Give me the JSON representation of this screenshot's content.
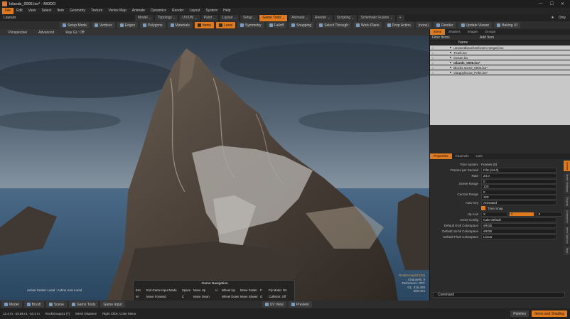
{
  "window": {
    "title": "Islands_0006.lxo* - MODO",
    "controls": [
      "—",
      "☐",
      "✕"
    ]
  },
  "menu": [
    "File",
    "Edit",
    "View",
    "Select",
    "Item",
    "Geometry",
    "Texture",
    "Vertex Map",
    "Animate",
    "Dynamics",
    "Render",
    "Layout",
    "System",
    "Help"
  ],
  "workspace_label": "Layouts",
  "tabs": [
    {
      "label": "Model"
    },
    {
      "label": "Topology"
    },
    {
      "label": "UV/UM"
    },
    {
      "label": "Paint"
    },
    {
      "label": "Layout"
    },
    {
      "label": "Setup"
    },
    {
      "label": "Game Tools",
      "active": true
    },
    {
      "label": "Animate"
    },
    {
      "label": "Render"
    },
    {
      "label": "Scripting"
    },
    {
      "label": "Schematic Fusion"
    }
  ],
  "tab_add": "+",
  "tabbar_right": [
    "★",
    "Only"
  ],
  "toolbar": [
    {
      "label": "Setup Mode",
      "icon": "setup-icon"
    },
    {
      "label": "Vertices",
      "icon": "vertex-icon"
    },
    {
      "label": "Edges",
      "icon": "edge-icon"
    },
    {
      "label": "Polygons",
      "icon": "polygon-icon"
    },
    {
      "label": "Materials",
      "icon": "material-icon"
    },
    {
      "label": "Items",
      "icon": "items-icon",
      "active": true
    },
    {
      "label": "Local",
      "icon": "local-icon",
      "active": true
    },
    {
      "label": "Symmetry",
      "icon": "symmetry-icon"
    },
    {
      "label": "Falloff",
      "icon": "falloff-icon"
    },
    {
      "label": "Snapping",
      "icon": "snapping-icon"
    },
    {
      "label": "Select Through",
      "icon": "select-icon"
    },
    {
      "label": "Work Plane",
      "icon": "workplane-icon"
    },
    {
      "label": "Drop Action",
      "icon": "drop-icon"
    },
    {
      "label": "(none)",
      "icon": ""
    },
    {
      "label": "Render",
      "icon": "render-icon"
    },
    {
      "label": "Update Viewer",
      "icon": "update-icon"
    },
    {
      "label": "Baking UI",
      "icon": "bake-icon"
    }
  ],
  "viewport": {
    "header": [
      "Perspective",
      "Advanced",
      "Ray GL: Off"
    ],
    "action_center": "Action Center Local : Action Axis Local",
    "stats": [
      "RockGroup22 (52)",
      "Channels: 9",
      "Deformers: OFF",
      "GL: 416,408",
      "500 mm"
    ],
    "colors": {
      "sky_top": "#3d4a57",
      "sky_mid": "#6d7d8d",
      "water": "#3a5a7a",
      "rock": "#4a4038"
    }
  },
  "game_nav": {
    "title": "Game Navigation",
    "rows": [
      [
        "Esc",
        "Exit Game Input Mode",
        "Space",
        "Move Up",
        "+/-",
        "Wheel Up",
        "Move Faster",
        "F",
        "Fly Mode: On"
      ],
      [
        "W",
        "Move Forward",
        "C",
        "Move Down",
        "",
        "Wheel Down",
        "Move Slower",
        "G",
        "Collision: Off"
      ],
      [
        "A",
        "Move Left",
        "Shift",
        "Run",
        "]",
        "",
        "Turn Faster",
        "I",
        "Show Info: Off"
      ],
      [
        "S",
        "Move Backward",
        "Ctrl",
        "Crawl",
        "[",
        "",
        "Turn Slower",
        "Y",
        "Invert Y: Off"
      ],
      [
        "D",
        "Move Right",
        "",
        "",
        "",
        "",
        "Reset",
        "",
        ""
      ]
    ]
  },
  "statusbar": [
    {
      "label": "Model",
      "icon": "model-icon"
    },
    {
      "label": "Brush",
      "icon": "brush-icon"
    },
    {
      "label": "Scene",
      "icon": "scene-icon"
    },
    {
      "label": "Game Tools",
      "icon": "game-icon"
    },
    {
      "label": "Game Input",
      "icon": ""
    },
    {
      "label": "UV View",
      "icon": "uv-icon"
    },
    {
      "label": "Preview",
      "icon": "preview-icon"
    }
  ],
  "infobar": [
    "12.4 m, -10.66 m, -10.4 m",
    "RockGroup21 (7)",
    "Mesh Distance",
    "Right Click: Color Menu"
  ],
  "bottom_right": [
    {
      "label": "Palettes"
    },
    {
      "label": "Items and Shading",
      "active": true
    }
  ],
  "items_panel": {
    "tabs": [
      "Items",
      "Shaders",
      "Images",
      "Groups"
    ],
    "filter_label": "Filter Items",
    "add_item": "Add Item",
    "column": "Name",
    "items": [
      {
        "name": "unsavedbeachesfrozen-merged.lxo",
        "bold": false
      },
      {
        "name": "Trunk.lxo",
        "bold": false
      },
      {
        "name": "Ocean.lxo",
        "bold": false
      },
      {
        "name": "Islands_0006.lxo*",
        "bold": true
      },
      {
        "name": "Blocks scene_0002.lxo*",
        "bold": false
      },
      {
        "name": "GargoyleLow_Pebs.lxo*",
        "bold": false
      }
    ]
  },
  "properties_panel": {
    "tabs": [
      "Properties",
      "Channels",
      "Lists"
    ],
    "side_tabs": [
      "Scene",
      "Mesh Settings",
      "Display",
      "Animation",
      "Item Options",
      "Tags"
    ],
    "rows": [
      {
        "label": "Time System",
        "value": "Frames (0)",
        "type": "text"
      },
      {
        "label": "Frames per Second",
        "value": "Film (24.0)",
        "type": "select"
      },
      {
        "label": "Rate",
        "value": "24.0",
        "type": "input"
      },
      {
        "label": "Scene Range",
        "value": "0",
        "value2": "120",
        "type": "input2"
      },
      {
        "label": "Current Range",
        "value": "0",
        "value2": "120",
        "type": "input2"
      },
      {
        "label": "Auto Key",
        "value": "Animated",
        "type": "select"
      },
      {
        "label": "",
        "value": "Time Snap",
        "type": "check"
      },
      {
        "label": "Up Axis",
        "value": "X",
        "value_y": "Y",
        "value_z": "Z",
        "type": "axis"
      },
      {
        "label": "OCIO Config",
        "value": "nuke-default",
        "type": "select"
      },
      {
        "label": "Default 8-bit Colorspace",
        "value": "sRGB",
        "type": "select"
      },
      {
        "label": "Default 16-bit Colorspace",
        "value": "sRGB",
        "type": "select"
      },
      {
        "label": "Default Float Colorspace",
        "value": "Linear",
        "type": "select"
      }
    ],
    "command_label": "Command"
  }
}
